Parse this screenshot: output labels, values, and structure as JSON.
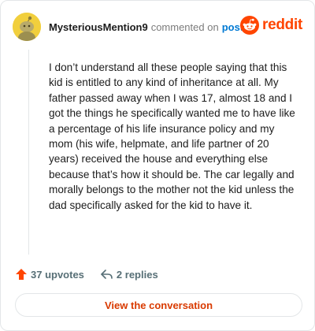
{
  "comment": {
    "username": "MysteriousMention9",
    "action_text": "commented on",
    "post_link": "post",
    "body": "I don’t understand all these people saying that this kid is entitled to any kind of inheritance at all. My father passed away when I was 17, almost 18 and I got the things he specifically wanted me to have like a percentage of his life insurance policy and my mom (his wife, helpmate, and life partner of 20 years) received the house and everything else because that’s how it should be. The car legally and morally belongs to the mother not the kid unless the dad specifically asked for the kid to have it."
  },
  "brand": {
    "name": "reddit",
    "color": "#ff4500",
    "icon": "reddit-logo-icon"
  },
  "stats": {
    "upvotes": "37 upvotes",
    "replies": "2 replies"
  },
  "cta": {
    "label": "View the conversation"
  },
  "colors": {
    "accent": "#ff4500",
    "link": "#0079d3",
    "cta_text": "#d93a00",
    "avatar": "#f1cf3d"
  }
}
